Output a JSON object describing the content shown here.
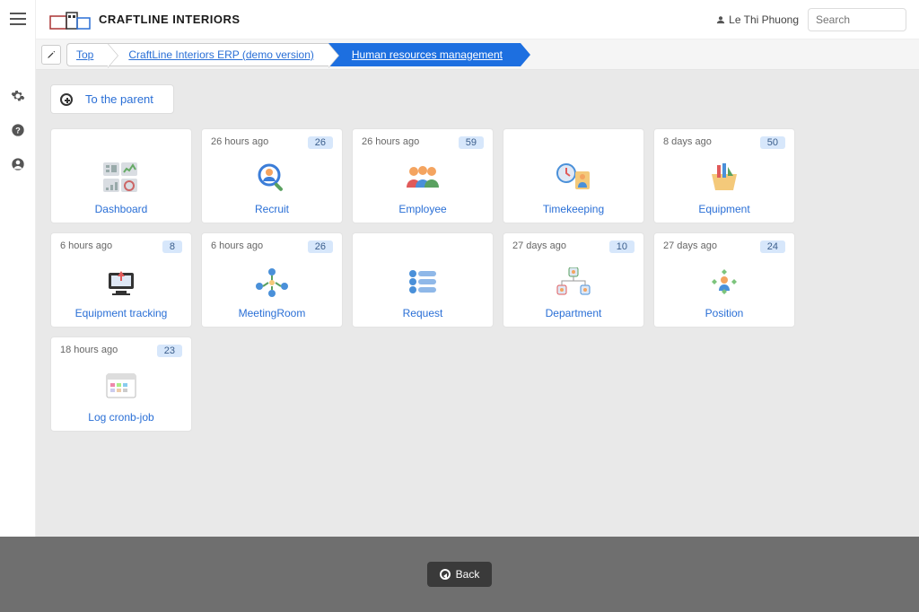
{
  "brand": "CRAFTLINE INTERIORS",
  "user_name": "Le Thi Phuong",
  "search_placeholder": "Search",
  "breadcrumb": {
    "top": "Top",
    "erp": "CraftLine Interiors ERP (demo version)",
    "current": "Human resources management"
  },
  "to_parent": "To the parent",
  "back_label": "Back",
  "cards": [
    {
      "time": "",
      "badge": "",
      "label": "Dashboard",
      "icon": "dashboard"
    },
    {
      "time": "26 hours ago",
      "badge": "26",
      "label": "Recruit",
      "icon": "recruit"
    },
    {
      "time": "26 hours ago",
      "badge": "59",
      "label": "Employee",
      "icon": "employee"
    },
    {
      "time": "",
      "badge": "",
      "label": "Timekeeping",
      "icon": "timekeeping"
    },
    {
      "time": "8 days ago",
      "badge": "50",
      "label": "Equipment",
      "icon": "equipment"
    },
    {
      "time": "6 hours ago",
      "badge": "8",
      "label": "Equipment tracking",
      "icon": "track"
    },
    {
      "time": "6 hours ago",
      "badge": "26",
      "label": "MeetingRoom",
      "icon": "meeting"
    },
    {
      "time": "",
      "badge": "",
      "label": "Request",
      "icon": "request"
    },
    {
      "time": "27 days ago",
      "badge": "10",
      "label": "Department",
      "icon": "dept"
    },
    {
      "time": "27 days ago",
      "badge": "24",
      "label": "Position",
      "icon": "position"
    },
    {
      "time": "18 hours ago",
      "badge": "23",
      "label": "Log cronb-job",
      "icon": "log"
    }
  ]
}
